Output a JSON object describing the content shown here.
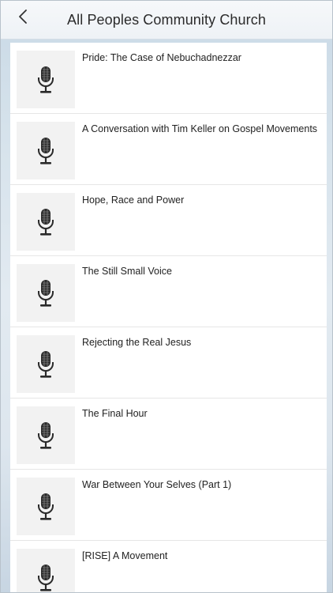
{
  "header": {
    "title": "All Peoples Community Church",
    "back_icon": "chevron-left-icon"
  },
  "list": {
    "item_icon": "microphone-icon",
    "items": [
      {
        "label": "Pride: The Case of Nebuchadnezzar"
      },
      {
        "label": "A Conversation with Tim Keller on Gospel Movements"
      },
      {
        "label": "Hope, Race and Power"
      },
      {
        "label": "The Still Small Voice"
      },
      {
        "label": "Rejecting the Real Jesus"
      },
      {
        "label": "The Final Hour"
      },
      {
        "label": "War Between Your Selves (Part 1)"
      },
      {
        "label": "[RISE] A Movement"
      }
    ]
  }
}
